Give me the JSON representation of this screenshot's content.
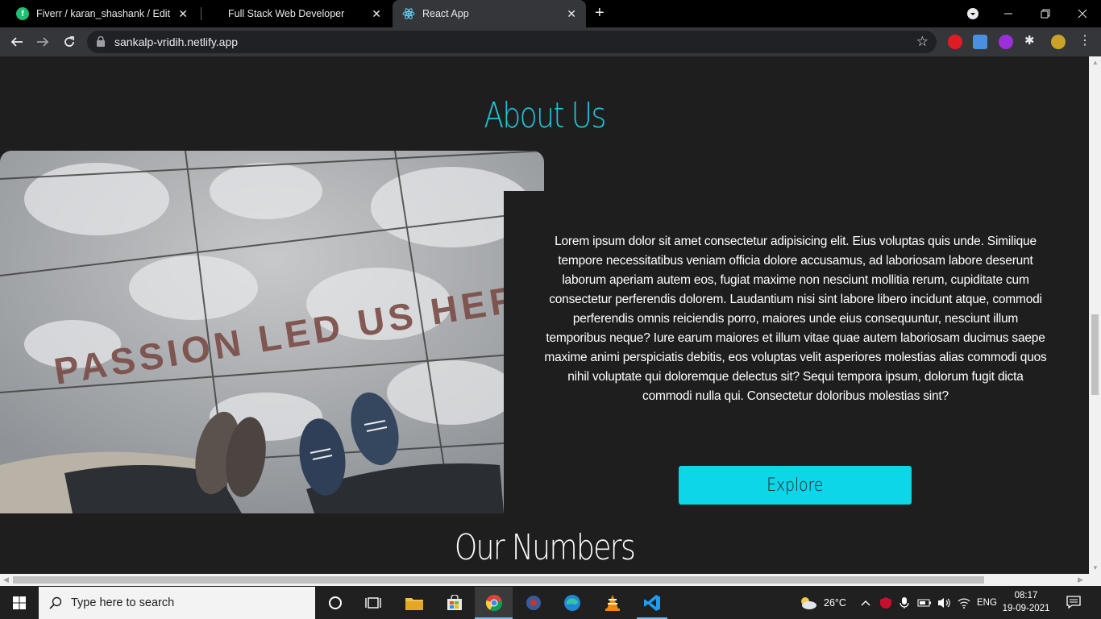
{
  "browser": {
    "tabs": [
      {
        "title": "Fiverr / karan_shashank / Edit Gig",
        "icon": "fiverr-icon",
        "active": false
      },
      {
        "title": "Full Stack Web Developer",
        "icon": "blank-icon",
        "active": false
      },
      {
        "title": "React App",
        "icon": "react-icon",
        "active": true
      }
    ],
    "close_glyph": "✕",
    "new_tab_glyph": "+",
    "url": "sankalp-vridih.netlify.app"
  },
  "page": {
    "about_title": "About Us",
    "about_text": "Lorem ipsum dolor sit amet consectetur adipisicing elit. Eius voluptas quis unde. Similique tempore necessitatibus veniam officia dolore accusamus, ad laboriosam labore deserunt laborum aperiam autem eos, fugiat maxime non nesciunt mollitia rerum, cupiditate cum consectetur perferendis dolorem. Laudantium nisi sint labore libero incidunt atque, commodi perferendis omnis reiciendis porro, maiores unde eius consequuntur, nesciunt illum temporibus neque? Iure earum maiores et illum vitae quae autem laboriosam ducimus saepe maxime animi perspiciatis debitis, eos voluptas velit asperiores molestias alias commodi quos nihil voluptate qui doloremque delectus sit? Sequi tempora ipsum, dolorum fugit dicta commodi nulla qui. Consectetur doloribus molestias sint?",
    "photo_caption": "PASSION LED US HERE",
    "explore_label": "Explore",
    "numbers_title": "Our Numbers"
  },
  "taskbar": {
    "search_placeholder": "Type here to search",
    "weather": "26°C",
    "language": "ENG",
    "time": "08:17",
    "date": "19-09-2021"
  },
  "colors": {
    "accent": "#1fc6dc",
    "button": "#0cd6e8",
    "page_bg": "#1e1e1e"
  }
}
